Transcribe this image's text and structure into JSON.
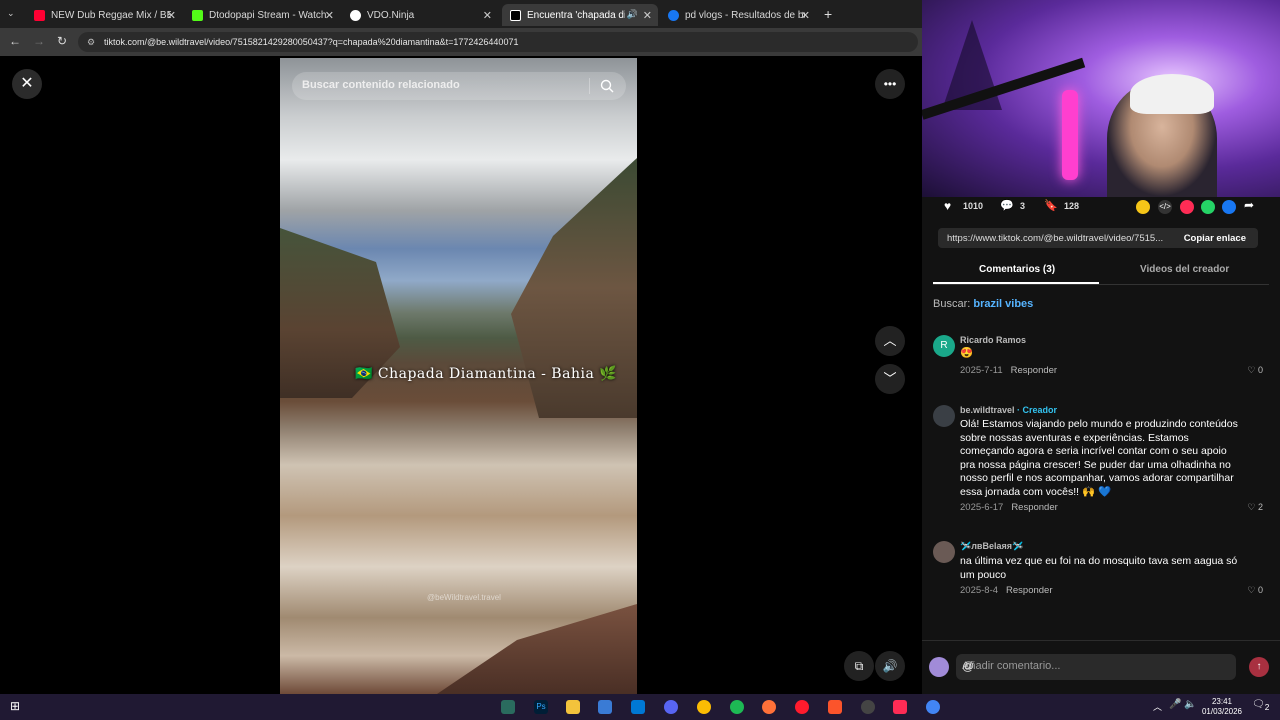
{
  "browser": {
    "tabs": [
      {
        "title": "NEW Dub Reggae Mix / BEST R",
        "favicon": "youtube-icon",
        "color": "#ff0033"
      },
      {
        "title": "Dtodopapi Stream - Watch Live",
        "favicon": "kick-icon",
        "color": "#53fc18"
      },
      {
        "title": "VDO.Ninja",
        "favicon": "ninja-icon",
        "color": "#ffffff"
      },
      {
        "title": "Encuentra 'chapada diamantina'",
        "favicon": "tiktok-icon",
        "color": "#ffffff",
        "active": true
      },
      {
        "title": "pd vlogs - Resultados de búsque",
        "favicon": "facebook-icon",
        "color": "#1877f2"
      }
    ],
    "new_tab": "+",
    "url": "tiktok.com/@be.wildtravel/video/7515821429280050437?q=chapada%20diamantina&t=1772426440071"
  },
  "video": {
    "search_placeholder": "Buscar contenido relacionado",
    "overlay_text": "🇧🇷 Chapada Diamantina - Bahia 🌿",
    "watermark": "@beWildtravel.travel"
  },
  "panel": {
    "likes": "1010",
    "comments_count": "3",
    "saves": "128",
    "share_link": "https://www.tiktok.com/@be.wildtravel/video/7515...",
    "copy_label": "Copiar enlace",
    "tab_comments": "Comentarios (3)",
    "tab_creator": "Videos del creador",
    "buscar_label": "Buscar:",
    "buscar_query": "brazil vibes",
    "comments": [
      {
        "name": "Ricardo Ramos",
        "creator": "",
        "text": "😍",
        "date": "2025-7-11",
        "reply": "Responder",
        "likes": "0",
        "avatar_letter": "R",
        "avatar_color": "#1aa88a"
      },
      {
        "name": "be.wildtravel",
        "creator": "· Creador",
        "text": "Olá! Estamos viajando pelo mundo e produzindo conteúdos sobre nossas aventuras e experiências. Estamos começando agora e seria incrível contar com o seu apoio pra nossa página crescer! Se puder dar uma olhadinha no nosso perfil e nos acompanhar, vamos adorar compartilhar essa jornada com vocês!! 🙌 💙",
        "date": "2025-6-17",
        "reply": "Responder",
        "likes": "2",
        "avatar_letter": "",
        "avatar_color": "#3a3f45"
      },
      {
        "name": "🛩️лвBelaяя🛩️",
        "creator": "",
        "text": "na última vez que eu foi na do mosquito tava sem aagua só um pouco",
        "date": "2025-8-4",
        "reply": "Responder",
        "likes": "0",
        "avatar_letter": "",
        "avatar_color": "#6a5a55"
      }
    ],
    "add_comment_placeholder": "Añadir comentario..."
  },
  "taskbar": {
    "time": "23:41",
    "date": "01/03/2026",
    "notifications": "2"
  }
}
